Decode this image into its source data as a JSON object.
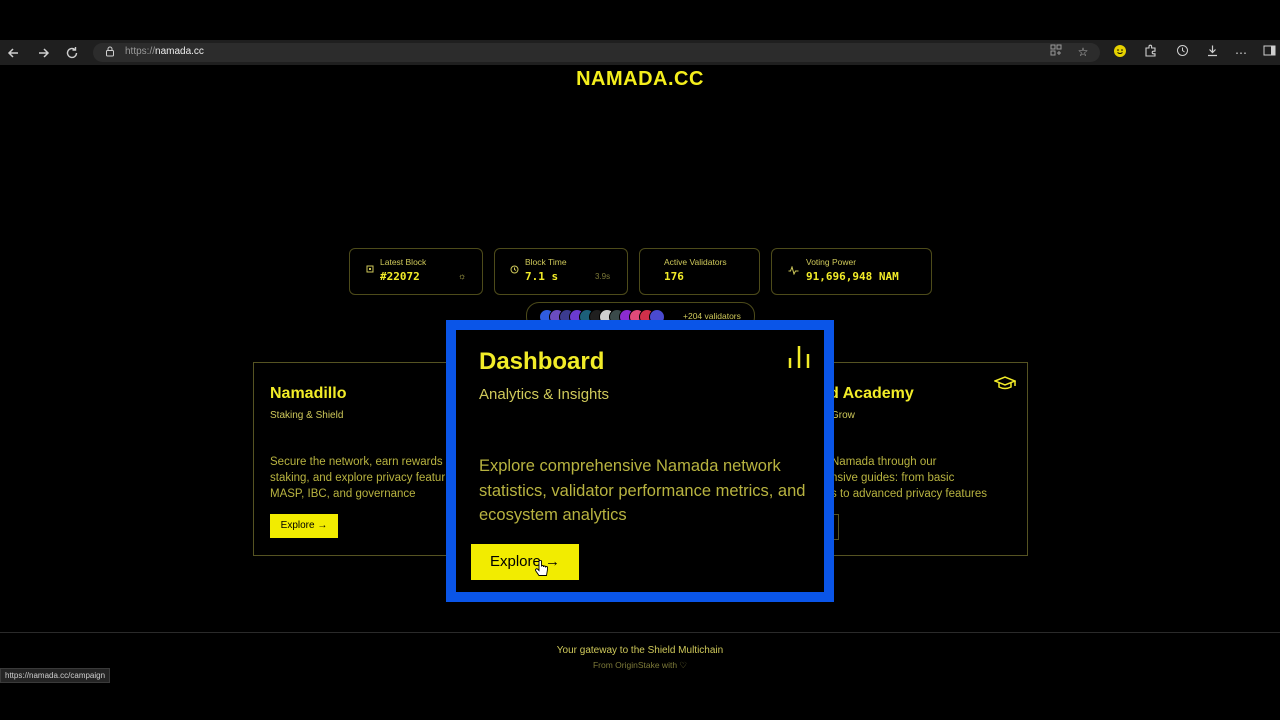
{
  "browser": {
    "url_scheme": "https://",
    "url_host": "namada.cc",
    "icons": [
      "back-icon",
      "forward-icon",
      "reload-icon",
      "lock-icon",
      "apps-icon",
      "star-icon",
      "profile-icon",
      "extensions-icon",
      "history-icon",
      "download-icon",
      "more-icon",
      "sidebar-icon"
    ]
  },
  "site": {
    "logo": "NAMADA.CC"
  },
  "stats": [
    {
      "label": "Latest Block",
      "value": "#22072"
    },
    {
      "label": "Block Time",
      "value": "7.1 s",
      "sub": "3.9s"
    },
    {
      "label": "Active Validators",
      "value": "176"
    },
    {
      "label": "Voting Power",
      "value": "91,696,948 NAM"
    }
  ],
  "validators": {
    "more_label": "+204 validators",
    "avatar_colors": [
      "#2f5ce0",
      "#6a4cc0",
      "#3b3b8f",
      "#6a3ad0",
      "#1c5f7a",
      "#1f1f1f",
      "#cfcfcf",
      "#3a4a4a",
      "#8a2bd0",
      "#e04a7a",
      "#d0304a",
      "#4a4ad0"
    ]
  },
  "cards": {
    "left": {
      "title": "Namadillo",
      "subtitle": "Staking & Shield",
      "desc_lines": [
        "Secure the network, earn rewards",
        "staking, and explore privacy featur",
        "MASP, IBC, and governance"
      ],
      "button": "Explore →"
    },
    "right": {
      "title": "d Academy",
      "subtitle": "Grow",
      "desc_lines": [
        "Namada through our",
        "nsive guides: from basic",
        "s to advanced privacy features"
      ]
    }
  },
  "overlay": {
    "title": "Dashboard",
    "subtitle": "Analytics & Insights",
    "description": "Explore comprehensive Namada network statistics, validator performance metrics, and ecosystem analytics",
    "button": "Explore →",
    "accent": "#0a55e8"
  },
  "footer": {
    "tagline": "Your gateway to the Shield Multichain",
    "credit": "From OriginStake with ♡"
  },
  "status_bar": {
    "url": "https://namada.cc/campaign"
  },
  "colors": {
    "brand_yellow": "#f2ec00",
    "background": "#000000"
  }
}
